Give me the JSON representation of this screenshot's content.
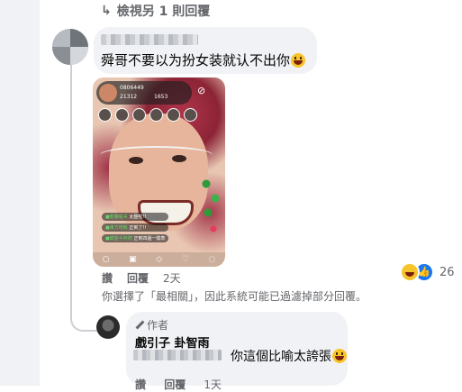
{
  "thread": {
    "view_more_icon": "reply-arrow-icon",
    "view_more_label": "檢視另 1 則回覆"
  },
  "comment1": {
    "text": "舜哥不要以为扮女装就认不出你",
    "emoji": "laughing-emoji",
    "actions": {
      "like": "讚",
      "reply": "回覆",
      "time": "2天"
    },
    "reactions": {
      "types": [
        "haha",
        "like"
      ],
      "count": "26"
    },
    "photo": {
      "stream_id": "0806449",
      "viewers": "21312",
      "count": "1653",
      "chat_lines": [
        {
          "user": "■龍騰羅哥",
          "msg": "太整啦!!"
        },
        {
          "user": "■東方皓敏",
          "msg": "正到了!!"
        },
        {
          "user": "■鍵盤手阿德",
          "msg": "正到四邊一樣表"
        }
      ]
    }
  },
  "notice": "你選擇了「最相關」，因此系統可能已過濾掉部分回覆。",
  "comment2": {
    "author_badge": "作者",
    "name": "戲引子 卦智雨",
    "text": "你這個比喻太誇張",
    "emoji": "laughing-emoji",
    "actions": {
      "like": "讚",
      "reply": "回覆",
      "time": "1天"
    }
  }
}
